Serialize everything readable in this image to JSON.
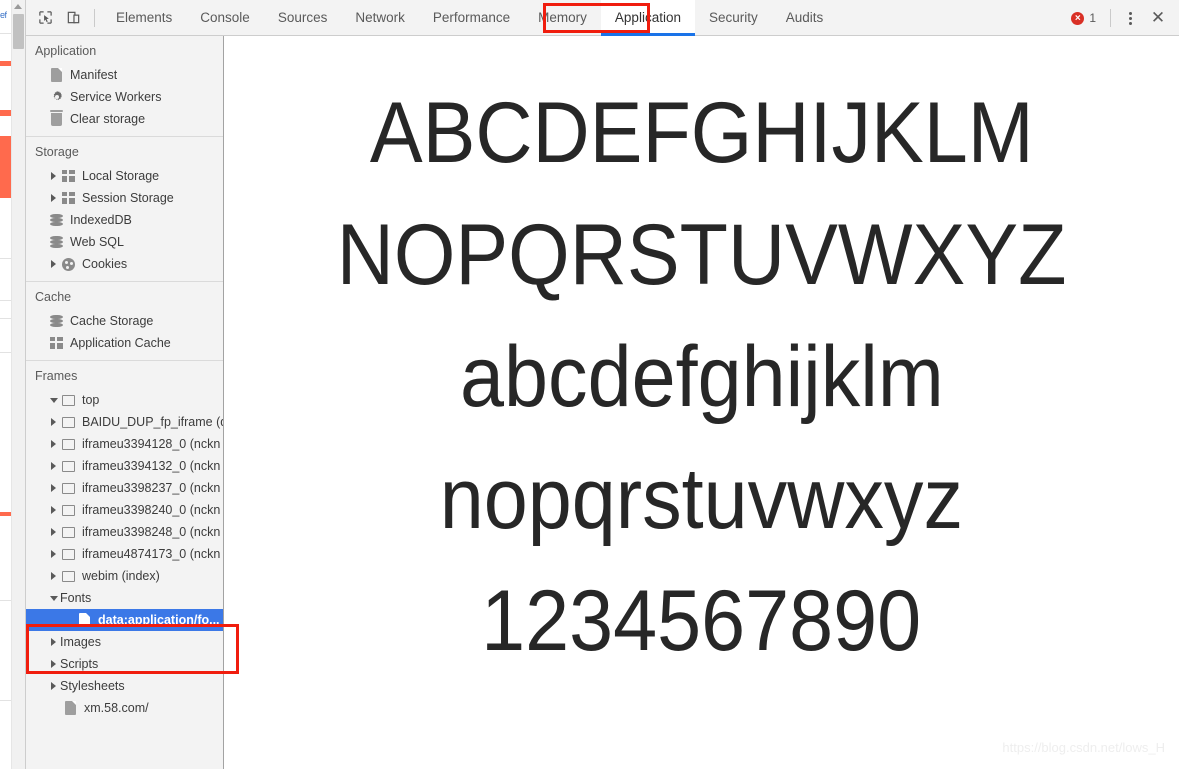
{
  "window": {
    "host_page_fragment": "ef"
  },
  "toolbar": {
    "inspect_icon": "inspect-cursor-icon",
    "device_icon": "device-toolbar-icon",
    "tabs": [
      {
        "label": "Elements",
        "active": false
      },
      {
        "label": "Console",
        "active": false
      },
      {
        "label": "Sources",
        "active": false
      },
      {
        "label": "Network",
        "active": false
      },
      {
        "label": "Performance",
        "active": false
      },
      {
        "label": "Memory",
        "active": false
      },
      {
        "label": "Application",
        "active": true
      },
      {
        "label": "Security",
        "active": false
      },
      {
        "label": "Audits",
        "active": false
      }
    ],
    "error_count": "1",
    "error_glyph": "×",
    "menu_icon": "kebab-menu-icon",
    "close_icon": "✕"
  },
  "sidebar": {
    "sections": [
      {
        "title": "Application",
        "items": [
          {
            "label": "Manifest",
            "icon": "document-icon",
            "twisty": "none",
            "indent": 2
          },
          {
            "label": "Service Workers",
            "icon": "gear-icon",
            "twisty": "none",
            "indent": 2
          },
          {
            "label": "Clear storage",
            "icon": "trash-icon",
            "twisty": "none",
            "indent": 2
          }
        ]
      },
      {
        "title": "Storage",
        "items": [
          {
            "label": "Local Storage",
            "icon": "table-icon",
            "twisty": "right",
            "indent": 1
          },
          {
            "label": "Session Storage",
            "icon": "table-icon",
            "twisty": "right",
            "indent": 1
          },
          {
            "label": "IndexedDB",
            "icon": "database-icon",
            "twisty": "none",
            "indent": 2
          },
          {
            "label": "Web SQL",
            "icon": "database-icon",
            "twisty": "none",
            "indent": 2
          },
          {
            "label": "Cookies",
            "icon": "cookie-icon",
            "twisty": "right",
            "indent": 1
          }
        ]
      },
      {
        "title": "Cache",
        "items": [
          {
            "label": "Cache Storage",
            "icon": "database-icon",
            "twisty": "none",
            "indent": 2
          },
          {
            "label": "Application Cache",
            "icon": "table-icon",
            "twisty": "none",
            "indent": 2
          }
        ]
      },
      {
        "title": "Frames",
        "items": [
          {
            "label": "top",
            "icon": "frame-icon",
            "twisty": "down",
            "indent": 1
          },
          {
            "label": "BAIDU_DUP_fp_iframe (d",
            "icon": "frame-icon",
            "twisty": "right",
            "indent": 2
          },
          {
            "label": "iframeu3394128_0 (nckn",
            "icon": "frame-icon",
            "twisty": "right",
            "indent": 2
          },
          {
            "label": "iframeu3394132_0 (nckn",
            "icon": "frame-icon",
            "twisty": "right",
            "indent": 2
          },
          {
            "label": "iframeu3398237_0 (nckn",
            "icon": "frame-icon",
            "twisty": "right",
            "indent": 2
          },
          {
            "label": "iframeu3398240_0 (nckn",
            "icon": "frame-icon",
            "twisty": "right",
            "indent": 2
          },
          {
            "label": "iframeu3398248_0 (nckn",
            "icon": "frame-icon",
            "twisty": "right",
            "indent": 2
          },
          {
            "label": "iframeu4874173_0 (nckn",
            "icon": "frame-icon",
            "twisty": "right",
            "indent": 2
          },
          {
            "label": "webim (index)",
            "icon": "frame-icon",
            "twisty": "right",
            "indent": 2
          },
          {
            "label": "Fonts",
            "icon": "none",
            "twisty": "down",
            "indent": 2
          },
          {
            "label": "data:application/fo...",
            "icon": "document-icon",
            "twisty": "none",
            "indent": 4,
            "selected": true
          },
          {
            "label": "Images",
            "icon": "none",
            "twisty": "right",
            "indent": 2
          },
          {
            "label": "Scripts",
            "icon": "none",
            "twisty": "right",
            "indent": 2
          },
          {
            "label": "Stylesheets",
            "icon": "none",
            "twisty": "right",
            "indent": 2
          },
          {
            "label": "xm.58.com/",
            "icon": "document-icon",
            "twisty": "none",
            "indent": 3
          }
        ]
      }
    ]
  },
  "main": {
    "font_preview_lines": [
      "ABCDEFGHIJKLM",
      "NOPQRSTUVWXYZ",
      "abcdefghijklm",
      "nopqrstuvwxyz",
      "1234567890"
    ],
    "watermark": "https://blog.csdn.net/lows_H"
  },
  "annotations": {
    "accent_color": "#f01d0e",
    "tab_highlight": "Application",
    "font_entry_highlight": "data:application/fo..."
  },
  "colors": {
    "selected_row": "#3b78e7",
    "active_tab_underline": "#1a73e8",
    "error_badge": "#d93025",
    "annotation_red": "#f01d0e",
    "sidebar_bg": "#f3f3f3"
  }
}
